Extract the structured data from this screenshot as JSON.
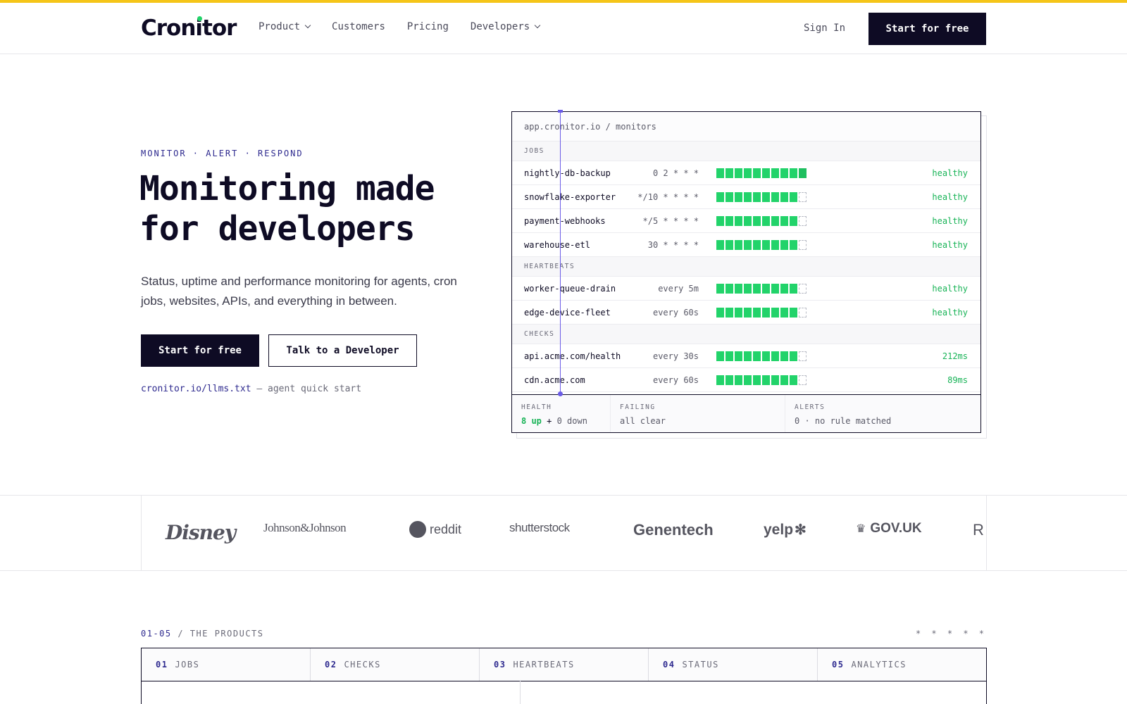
{
  "nav": {
    "brand": "Cronitor",
    "links": [
      {
        "label": "Product",
        "dropdown": true
      },
      {
        "label": "Customers",
        "dropdown": false
      },
      {
        "label": "Pricing",
        "dropdown": false
      },
      {
        "label": "Developers",
        "dropdown": true
      }
    ],
    "sign_in": "Sign In",
    "cta": "Start for free"
  },
  "hero": {
    "eyebrow": "MONITOR · ALERT · RESPOND",
    "title": "Monitoring made for developers",
    "subtitle": "Status, uptime and performance monitoring for agents, cron jobs, websites, APIs, and everything in between.",
    "primary_cta": "Start for free",
    "secondary_cta": "Talk to a Developer",
    "llms_link": "cronitor.io/llms.txt",
    "llms_note": "— agent quick start"
  },
  "dashboard": {
    "url": "app.cronitor.io / monitors",
    "sections": [
      {
        "label": "JOBS",
        "rows": [
          {
            "name": "nightly-db-backup",
            "schedule": "0 2 * * *",
            "status": "healthy",
            "bars_filled": 10,
            "bars_total": 10
          },
          {
            "name": "snowflake-exporter",
            "schedule": "*/10 * * * *",
            "status": "healthy",
            "bars_filled": 9,
            "bars_total": 10
          },
          {
            "name": "payment-webhooks",
            "schedule": "*/5 * * * *",
            "status": "healthy",
            "bars_filled": 9,
            "bars_total": 10
          },
          {
            "name": "warehouse-etl",
            "schedule": "30 * * * *",
            "status": "healthy",
            "bars_filled": 9,
            "bars_total": 10
          }
        ]
      },
      {
        "label": "HEARTBEATS",
        "rows": [
          {
            "name": "worker-queue-drain",
            "schedule": "every 5m",
            "status": "healthy",
            "bars_filled": 9,
            "bars_total": 10
          },
          {
            "name": "edge-device-fleet",
            "schedule": "every 60s",
            "status": "healthy",
            "bars_filled": 9,
            "bars_total": 10
          }
        ]
      },
      {
        "label": "CHECKS",
        "rows": [
          {
            "name": "api.acme.com/health",
            "schedule": "every 30s",
            "status": "212ms",
            "bars_filled": 9,
            "bars_total": 10
          },
          {
            "name": "cdn.acme.com",
            "schedule": "every 60s",
            "status": "89ms",
            "bars_filled": 9,
            "bars_total": 10
          }
        ]
      }
    ],
    "footer": {
      "health_label": "HEALTH",
      "health_up": "8 up",
      "health_plus": "+",
      "health_down": "0 down",
      "failing_label": "FAILING",
      "failing_value": "all clear",
      "alerts_label": "ALERTS",
      "alerts_value": "0 · no rule matched"
    }
  },
  "customers": [
    "Disney",
    "Johnson&Johnson",
    "reddit",
    "shutterstock",
    "Genentech",
    "yelp",
    "GOV.UK",
    "R"
  ],
  "products": {
    "range": "01-05",
    "heading": "/ THE PRODUCTS",
    "stars": "* * * * *",
    "tabs": [
      {
        "num": "01",
        "label": "JOBS"
      },
      {
        "num": "02",
        "label": "CHECKS"
      },
      {
        "num": "03",
        "label": "HEARTBEATS"
      },
      {
        "num": "04",
        "label": "STATUS"
      },
      {
        "num": "05",
        "label": "ANALYTICS"
      }
    ]
  },
  "colors": {
    "accent_bar": "#f5c518",
    "ink": "#0e0b24",
    "indigo": "#2e2a8f",
    "healthy_green": "#22d36a",
    "cursor_purple": "#6b5ce7"
  }
}
